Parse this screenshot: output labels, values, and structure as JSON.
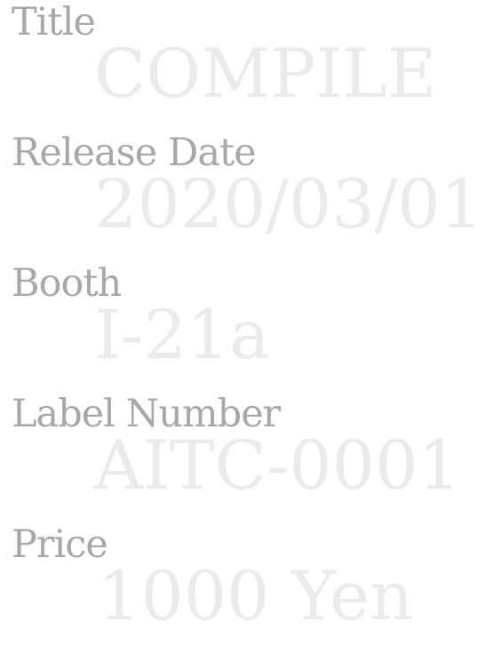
{
  "entries": [
    {
      "label": "Title",
      "value": "COMPILE"
    },
    {
      "label": "Release Date",
      "value": "2020/03/01"
    },
    {
      "label": "Booth",
      "value": "I-21a"
    },
    {
      "label": "Label Number",
      "value": "AITC-0001"
    },
    {
      "label": "Price",
      "value": "1000 Yen"
    }
  ],
  "colors": {
    "label": "#a8a8a8",
    "value": "#ebebeb",
    "background": "#ffffff"
  }
}
